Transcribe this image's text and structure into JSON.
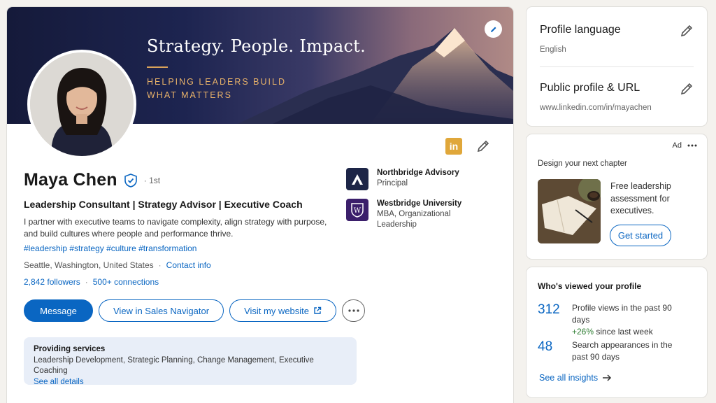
{
  "banner": {
    "title": "Strategy. People. Impact.",
    "subtitle": "HELPING LEADERS BUILD WHAT MATTERS"
  },
  "profile": {
    "name": "Maya Chen",
    "degree": "· 1st",
    "headline": "Leadership Consultant | Strategy Advisor | Executive Coach",
    "about": "I partner with executive teams to navigate complexity, align strategy with purpose, and build cultures where people and performance thrive.",
    "hashtags": "#leadership #strategy #culture #transformation",
    "location": "Seattle, Washington, United States",
    "contact_info": "Contact info",
    "followers": "2,842 followers",
    "connections": "500+ connections",
    "linkedin_badge": "in"
  },
  "buttons": {
    "message": "Message",
    "sales_navigator": "View in Sales Navigator",
    "website": "Visit my website"
  },
  "services": {
    "title": "Providing services",
    "list": "Leadership Development, Strategic Planning, Change Management, Executive Coaching",
    "link": "See all details"
  },
  "experience": [
    {
      "name": "Northbridge Advisory",
      "detail": "Principal"
    },
    {
      "name": "Westbridge University",
      "detail": "MBA, Organizational Leadership"
    }
  ],
  "sidebar": {
    "language_title": "Profile language",
    "language_value": "English",
    "public_title": "Public profile & URL",
    "public_value": "www.linkedin.com/in/mayachen"
  },
  "ad": {
    "label": "Ad",
    "heading": "Design your next chapter",
    "text": "Free leadership assessment for executives.",
    "cta": "Get started"
  },
  "views": {
    "title": "Who's viewed your profile",
    "profile_views": "312",
    "profile_views_label": "Profile views in the past 90 days",
    "profile_views_delta": "+26%",
    "profile_views_delta_label": "since last week",
    "search_appearances": "48",
    "search_appearances_label": "Search appearances in the past 90 days",
    "insights_link": "See all insights"
  },
  "colors": {
    "accent": "#0a66c2",
    "banner_gold": "#e7b169",
    "positive": "#2e7d32",
    "services_bg": "#e8eef8"
  }
}
